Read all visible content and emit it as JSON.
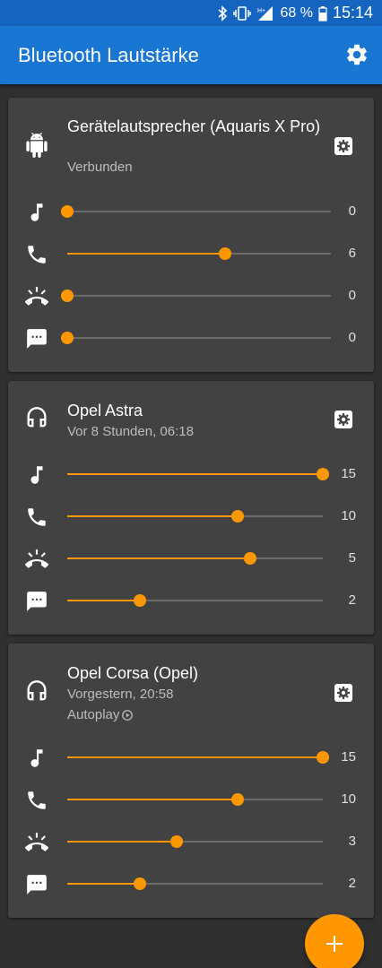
{
  "status": {
    "battery": "68 %",
    "time": "15:14"
  },
  "appbar": {
    "title": "Bluetooth Lautstärke"
  },
  "devices": [
    {
      "name": "Gerätelautsprecher (Aquaris X Pro)",
      "sub": "Verbunden",
      "icon": "android-icon",
      "sliders": [
        {
          "stream": "music",
          "icon": "music-note-icon",
          "value": "0",
          "max": 15
        },
        {
          "stream": "call",
          "icon": "phone-icon",
          "value": "6",
          "max": 10
        },
        {
          "stream": "ring",
          "icon": "ring-volume-icon",
          "value": "0",
          "max": 10
        },
        {
          "stream": "notification",
          "icon": "message-icon",
          "value": "0",
          "max": 10
        }
      ]
    },
    {
      "name": "Opel Astra",
      "sub": "Vor 8 Stunden, 06:18",
      "icon": "headphones-icon",
      "sliders": [
        {
          "stream": "music",
          "icon": "music-note-icon",
          "value": "15",
          "max": 15
        },
        {
          "stream": "call",
          "icon": "phone-icon",
          "value": "10",
          "max": 15
        },
        {
          "stream": "ring",
          "icon": "ring-volume-icon",
          "value": "5",
          "max": 7
        },
        {
          "stream": "notification",
          "icon": "message-icon",
          "value": "2",
          "max": 7
        }
      ]
    },
    {
      "name": "Opel Corsa (Opel)",
      "sub": "Vorgestern, 20:58",
      "sub2": "Autoplay",
      "icon": "headphones-icon",
      "sliders": [
        {
          "stream": "music",
          "icon": "music-note-icon",
          "value": "15",
          "max": 15
        },
        {
          "stream": "call",
          "icon": "phone-icon",
          "value": "10",
          "max": 15
        },
        {
          "stream": "ring",
          "icon": "ring-volume-icon",
          "value": "3",
          "max": 7
        },
        {
          "stream": "notification",
          "icon": "message-icon",
          "value": "2",
          "max": 7
        }
      ]
    }
  ],
  "colors": {
    "accent": "#ff9800",
    "appbar": "#1976D2",
    "statusbar": "#1565C0",
    "card": "#424242",
    "background": "#303030"
  }
}
